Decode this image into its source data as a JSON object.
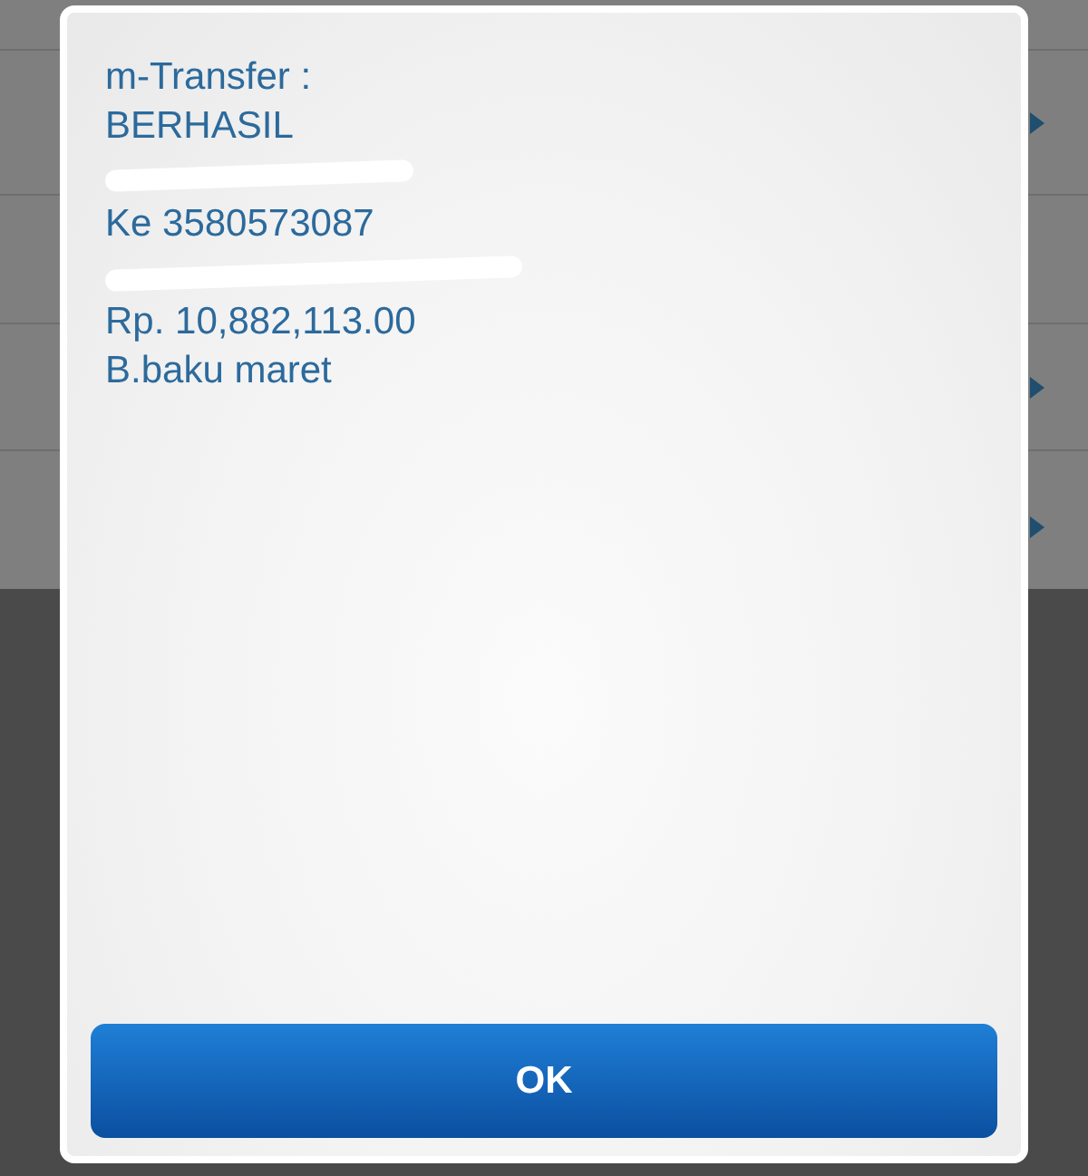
{
  "background_list": {
    "rows": [
      {
        "chevron": true
      },
      {
        "chevron": false
      },
      {
        "chevron": true
      },
      {
        "chevron": true
      }
    ]
  },
  "dialog": {
    "lines": [
      {
        "kind": "text",
        "text": "m-Transfer :"
      },
      {
        "kind": "text",
        "text": "BERHASIL"
      },
      {
        "kind": "redacted"
      },
      {
        "kind": "text",
        "text": "Ke 3580573087"
      },
      {
        "kind": "redacted"
      },
      {
        "kind": "text",
        "text": "Rp. 10,882,113.00"
      },
      {
        "kind": "text",
        "text": "B.baku maret"
      }
    ],
    "button": "OK"
  }
}
